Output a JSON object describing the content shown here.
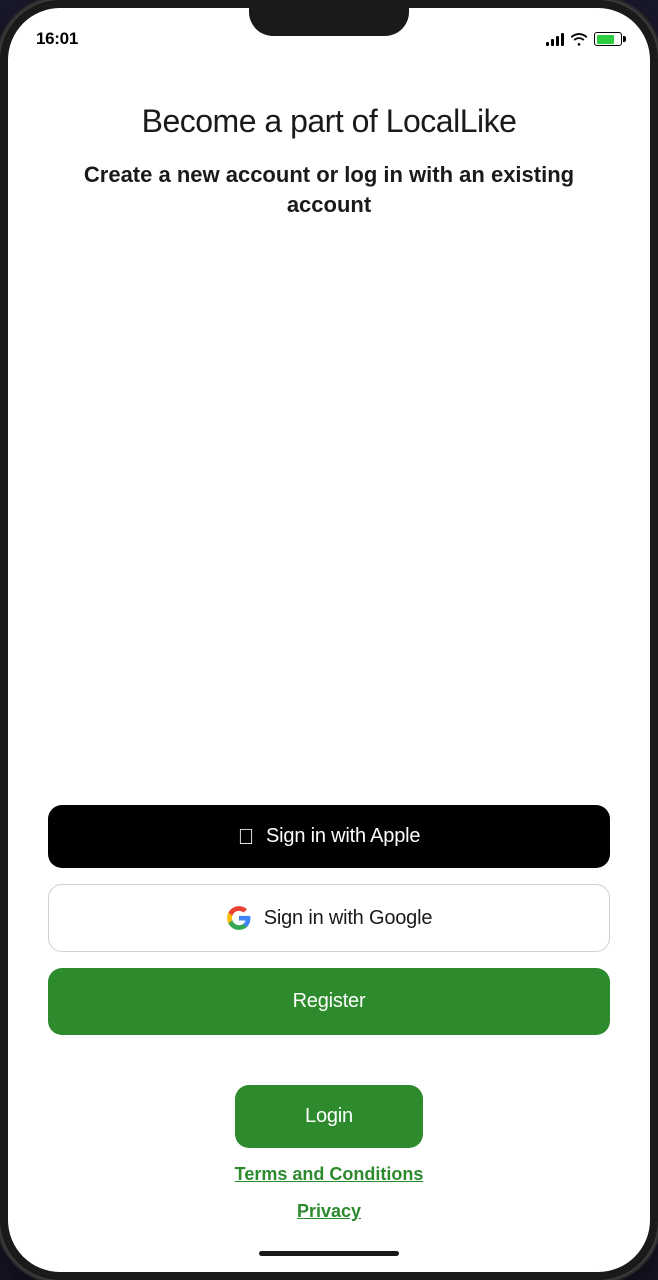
{
  "status_bar": {
    "time": "16:01",
    "battery_level": "75"
  },
  "header": {
    "title": "Become a part of LocalLike",
    "subtitle": "Create a new account or log in with an existing account"
  },
  "buttons": {
    "apple_label": "Sign in with Apple",
    "google_label": "Sign in with Google",
    "register_label": "Register",
    "login_label": "Login"
  },
  "footer": {
    "terms_label": "Terms and Conditions",
    "privacy_label": "Privacy"
  },
  "colors": {
    "green": "#2d8a2d",
    "black": "#000000",
    "white": "#ffffff"
  }
}
